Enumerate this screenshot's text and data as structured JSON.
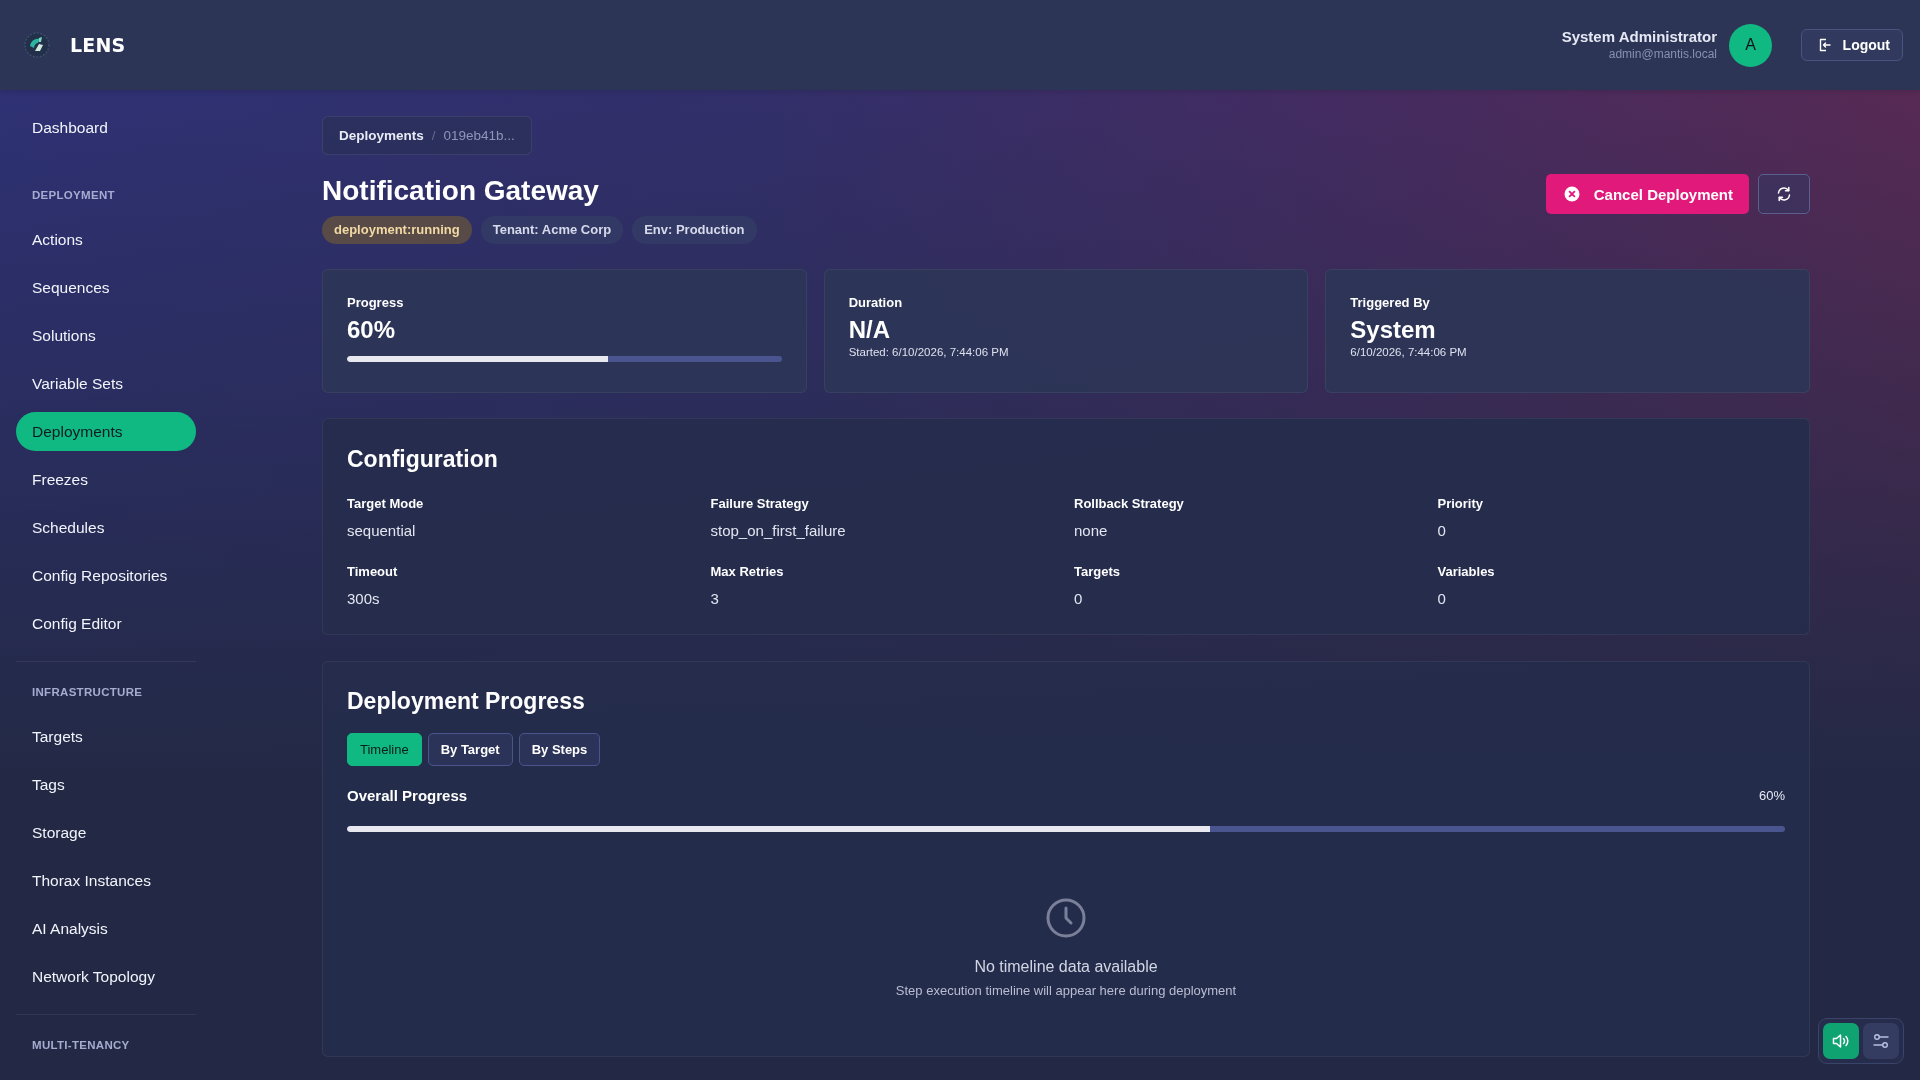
{
  "header": {
    "brand": "LENS",
    "user": {
      "name": "System Administrator",
      "email": "admin@mantis.local",
      "avatar_initial": "A"
    },
    "logout_label": "Logout"
  },
  "sidebar": {
    "groups": [
      {
        "items": [
          {
            "label": "Dashboard",
            "selected": false
          }
        ]
      },
      {
        "heading": "DEPLOYMENT",
        "items": [
          {
            "label": "Actions",
            "selected": false
          },
          {
            "label": "Sequences",
            "selected": false
          },
          {
            "label": "Solutions",
            "selected": false
          },
          {
            "label": "Variable Sets",
            "selected": false
          },
          {
            "label": "Deployments",
            "selected": true
          },
          {
            "label": "Freezes",
            "selected": false
          },
          {
            "label": "Schedules",
            "selected": false
          },
          {
            "label": "Config Repositories",
            "selected": false
          },
          {
            "label": "Config Editor",
            "selected": false
          }
        ]
      },
      {
        "heading": "INFRASTRUCTURE",
        "items": [
          {
            "label": "Targets",
            "selected": false
          },
          {
            "label": "Tags",
            "selected": false
          },
          {
            "label": "Storage",
            "selected": false
          },
          {
            "label": "Thorax Instances",
            "selected": false
          },
          {
            "label": "AI Analysis",
            "selected": false
          },
          {
            "label": "Network Topology",
            "selected": false
          }
        ]
      },
      {
        "heading": "MULTI-TENANCY"
      }
    ]
  },
  "breadcrumb": {
    "items": [
      "Deployments",
      "019eb41b..."
    ],
    "separator": "/"
  },
  "page": {
    "title": "Notification Gateway",
    "badges": [
      {
        "label": "deployment:running",
        "kind": "status"
      },
      {
        "label": "Tenant: Acme Corp",
        "kind": "meta"
      },
      {
        "label": "Env: Production",
        "kind": "meta"
      }
    ],
    "cancel_button": "Cancel Deployment"
  },
  "stats": [
    {
      "kind": "progress",
      "label": "Progress",
      "value": "60%",
      "level": 0.6
    },
    {
      "kind": "text",
      "label": "Duration",
      "value": "N/A",
      "note": "Started: 6/10/2026, 7:44:06 PM"
    },
    {
      "kind": "text",
      "label": "Triggered By",
      "value": "System",
      "note": "6/10/2026, 7:44:06 PM"
    }
  ],
  "configuration": {
    "title": "Configuration",
    "fields": [
      {
        "label": "Target Mode",
        "value": "sequential"
      },
      {
        "label": "Failure Strategy",
        "value": "stop_on_first_failure"
      },
      {
        "label": "Rollback Strategy",
        "value": "none"
      },
      {
        "label": "Priority",
        "value": "0"
      },
      {
        "label": "Timeout",
        "value": "300s"
      },
      {
        "label": "Max Retries",
        "value": "3"
      },
      {
        "label": "Targets",
        "value": "0"
      },
      {
        "label": "Variables",
        "value": "0"
      }
    ]
  },
  "deployment_progress": {
    "title": "Deployment Progress",
    "tabs": [
      {
        "label": "Timeline",
        "selected": true
      },
      {
        "label": "By Target",
        "selected": false
      },
      {
        "label": "By Steps",
        "selected": false
      }
    ],
    "overall": {
      "label": "Overall Progress",
      "reading": "60%",
      "level": 0.6
    },
    "empty_state": {
      "title": "No timeline data available",
      "message": "Step execution timeline will appear here during deployment"
    }
  },
  "floating_toolbar": [
    {
      "kind": "sound",
      "on": true
    },
    {
      "kind": "sliders",
      "on": false
    }
  ]
}
